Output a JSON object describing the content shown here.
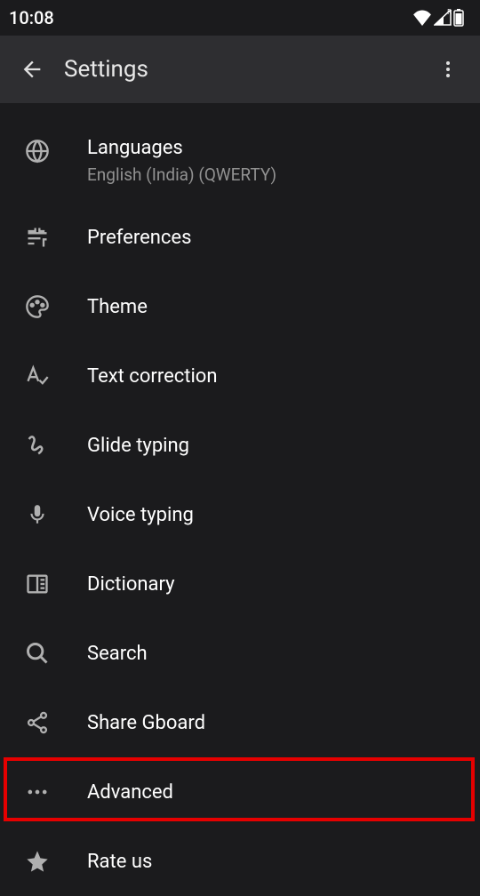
{
  "status_bar": {
    "time": "10:08"
  },
  "app_bar": {
    "title": "Settings"
  },
  "items": {
    "languages": {
      "title": "Languages",
      "subtitle": "English (India) (QWERTY)"
    },
    "preferences": {
      "title": "Preferences"
    },
    "theme": {
      "title": "Theme"
    },
    "text_correction": {
      "title": "Text correction"
    },
    "glide_typing": {
      "title": "Glide typing"
    },
    "voice_typing": {
      "title": "Voice typing"
    },
    "dictionary": {
      "title": "Dictionary"
    },
    "search": {
      "title": "Search"
    },
    "share_gboard": {
      "title": "Share Gboard"
    },
    "advanced": {
      "title": "Advanced"
    },
    "rate_us": {
      "title": "Rate us"
    }
  },
  "highlight": {
    "target": "advanced",
    "color": "#e60000"
  }
}
